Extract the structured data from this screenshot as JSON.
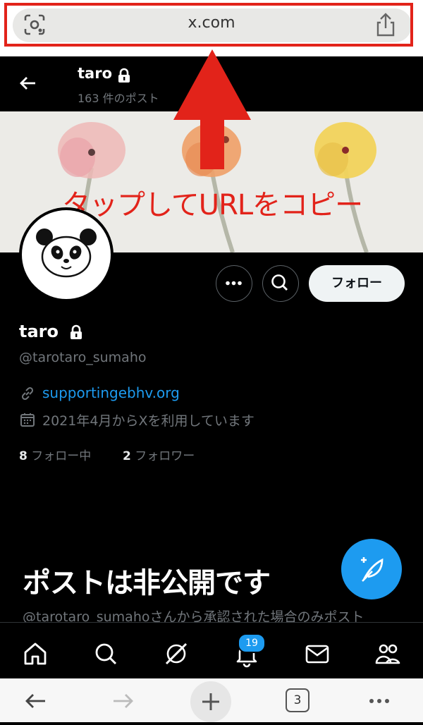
{
  "browser": {
    "url": "x.com",
    "tab_count": "3",
    "icons": [
      "lens-icon",
      "share-icon",
      "back-icon",
      "forward-icon",
      "new-tab-icon",
      "tabs-icon",
      "more-icon"
    ]
  },
  "annotation": {
    "text": "タップしてURLをコピー",
    "color": "#e2231a"
  },
  "profile": {
    "header_name": "taro",
    "post_count": "163 件のポスト",
    "display_name": "taro",
    "handle": "@tarotaro_sumaho",
    "link": "supportingebhv.org",
    "joined": "2021年4月からXを利用しています",
    "following_count": "8",
    "following_label": "フォロー中",
    "followers_count": "2",
    "followers_label": "フォロワー",
    "follow_button": "フォロー",
    "private_title": "ポストは非公開です",
    "private_subtitle": "@tarotaro_sumahoさんから承認された場合のみポスト"
  },
  "tabbar": {
    "items": [
      "home",
      "search",
      "grok",
      "notifications",
      "messages",
      "communities"
    ],
    "notification_badge": "19"
  },
  "colors": {
    "accent": "#1d9bf0",
    "background": "#000000",
    "annotation": "#e2231a"
  }
}
